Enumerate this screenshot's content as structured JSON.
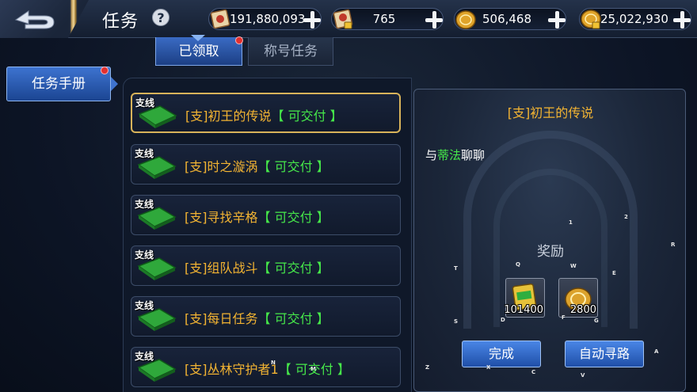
{
  "header": {
    "title": "任务",
    "help_symbol": "?"
  },
  "currencies": [
    {
      "name": "scroll-currency",
      "value": "191,880,093"
    },
    {
      "name": "locked-scroll-currency",
      "value": "765"
    },
    {
      "name": "gold-coin-currency",
      "value": "506,468"
    },
    {
      "name": "locked-gold-currency",
      "value": "25,022,930"
    }
  ],
  "tabs": [
    {
      "label": "已领取",
      "active": true,
      "badge": true
    },
    {
      "label": "称号任务",
      "active": false,
      "badge": false
    }
  ],
  "sidebar": {
    "items": [
      {
        "label": "任务手册",
        "badge": true
      }
    ]
  },
  "quest_list": {
    "branch_tag": "支线",
    "items": [
      {
        "name": "[支]初王的传说",
        "status": "【 可交付 】",
        "selected": true
      },
      {
        "name": "[支]时之漩涡",
        "status": "【 可交付 】",
        "selected": false
      },
      {
        "name": "[支]寻找辛格",
        "status": "【 可交付 】",
        "selected": false
      },
      {
        "name": "[支]组队战斗",
        "status": "【 可交付 】",
        "selected": false
      },
      {
        "name": "[支]每日任务",
        "status": "【 可交付 】",
        "selected": false
      },
      {
        "name": "[支]丛林守护者1",
        "status": "【 可交付 】",
        "selected": false
      }
    ]
  },
  "detail": {
    "title": "[支]初王的传说",
    "talk_prefix": "与",
    "npc": "蒂法",
    "talk_suffix": "聊聊",
    "reward_label": "奖励",
    "rewards": [
      {
        "name": "exp-book",
        "amount": "101400"
      },
      {
        "name": "gold-coin",
        "amount": "2800"
      }
    ],
    "complete_button": "完成",
    "autopath_button": "自动寻路"
  },
  "overlay_hints": [
    "1",
    "2",
    "R",
    "Q",
    "W",
    "T",
    "E",
    "S",
    "D",
    "F",
    "G",
    "A",
    "Z",
    "X",
    "C",
    "V",
    "N",
    "M"
  ],
  "colors": {
    "quest_name": "#f3b432",
    "quest_status": "#46e84a",
    "active_blue": "#2f62bd",
    "selected_border": "#d8b35a",
    "badge_red": "#e23030"
  }
}
